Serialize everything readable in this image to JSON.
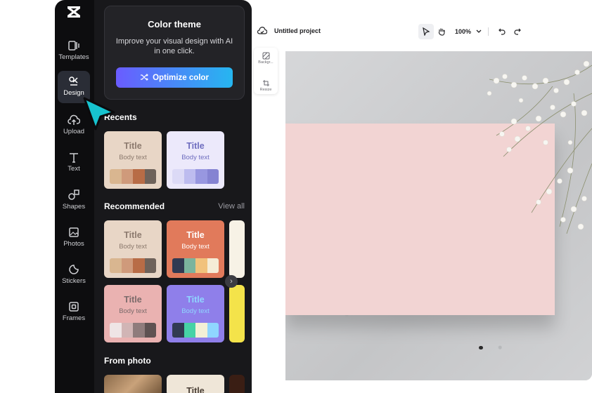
{
  "rail": {
    "logo": "capcut-logo",
    "items": [
      {
        "label": "Templates",
        "icon": "templates-icon"
      },
      {
        "label": "Design",
        "icon": "design-icon",
        "active": true
      },
      {
        "label": "Upload",
        "icon": "upload-icon"
      },
      {
        "label": "Text",
        "icon": "text-icon"
      },
      {
        "label": "Shapes",
        "icon": "shapes-icon"
      },
      {
        "label": "Photos",
        "icon": "photos-icon"
      },
      {
        "label": "Stickers",
        "icon": "stickers-icon"
      },
      {
        "label": "Frames",
        "icon": "frames-icon"
      }
    ]
  },
  "panel": {
    "theme": {
      "title": "Color theme",
      "desc": "Improve your visual design with AI in one click.",
      "button": "Optimize color"
    },
    "recents_title": "Recents",
    "recommended_title": "Recommended",
    "view_all": "View all",
    "from_photo_title": "From photo",
    "card_title": "Title",
    "card_body": "Body text",
    "recents": [
      {
        "bg": "#e8d6c6",
        "title": "#8c7a6e",
        "body": "#8c7a6e",
        "swatches": [
          "#d9b690",
          "#cf9a7b",
          "#b86c46",
          "#6e625a"
        ]
      },
      {
        "bg": "#ece9fb",
        "title": "#6e6dbf",
        "body": "#6e6dbf",
        "swatches": [
          "#dcdaf6",
          "#bdbcef",
          "#9897e0",
          "#8583d2"
        ]
      }
    ],
    "recommended": [
      {
        "bg": "#e8d6c6",
        "title": "#8c7a6e",
        "body": "#8c7a6e",
        "swatches": [
          "#d9b690",
          "#cf9a7b",
          "#b86c46",
          "#6e625a"
        ]
      },
      {
        "bg": "#e17a5b",
        "title": "#ffffff",
        "body": "#ffffff",
        "swatches": [
          "#313a52",
          "#7bb49e",
          "#f1c27c",
          "#f5ecd6"
        ]
      },
      {
        "bg": "#eab2b1",
        "title": "#7a6a6a",
        "body": "#7a6a6a",
        "swatches": [
          "#efe5e5",
          "#d1b5b5",
          "#8f7c7c",
          "#5e5252"
        ]
      },
      {
        "bg": "#8f7fea",
        "title": "#8fd6ff",
        "body": "#8fd6ff",
        "swatches": [
          "#313a52",
          "#46d2a6",
          "#f3f0d6",
          "#8fd6ff"
        ]
      }
    ]
  },
  "header": {
    "project_name": "Untitled project",
    "zoom": "100%"
  },
  "mini_tools": [
    {
      "label": "Backgr...",
      "icon": "background-icon"
    },
    {
      "label": "Resize",
      "icon": "resize-icon"
    }
  ]
}
